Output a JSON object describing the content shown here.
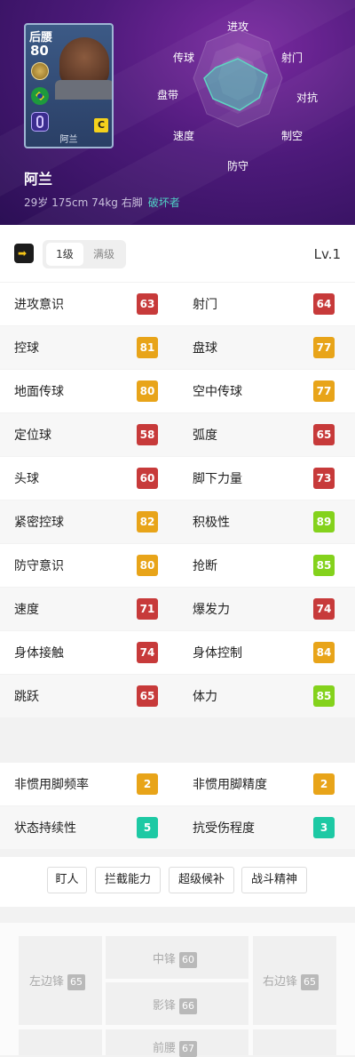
{
  "player": {
    "card_position": "后腰",
    "card_rating": "80",
    "card_name": "阿兰",
    "card_class": "C",
    "name": "阿兰",
    "info": "29岁 175cm 74kg 右脚",
    "play_style": "破坏者"
  },
  "radar": {
    "labels": [
      "进攻",
      "射门",
      "对抗",
      "制空",
      "防守",
      "速度",
      "盘带",
      "传球"
    ]
  },
  "level": {
    "tabs": [
      "1级",
      "满级"
    ],
    "active_tab": "1级",
    "current": "Lv.1"
  },
  "stats": [
    {
      "left": {
        "label": "进攻意识",
        "value": "63",
        "color": "#c73a3a"
      },
      "right": {
        "label": "射门",
        "value": "64",
        "color": "#c73a3a"
      }
    },
    {
      "left": {
        "label": "控球",
        "value": "81",
        "color": "#e8a419"
      },
      "right": {
        "label": "盘球",
        "value": "77",
        "color": "#e8a419"
      }
    },
    {
      "left": {
        "label": "地面传球",
        "value": "80",
        "color": "#e8a419"
      },
      "right": {
        "label": "空中传球",
        "value": "77",
        "color": "#e8a419"
      }
    },
    {
      "left": {
        "label": "定位球",
        "value": "58",
        "color": "#c73a3a"
      },
      "right": {
        "label": "弧度",
        "value": "65",
        "color": "#c73a3a"
      }
    },
    {
      "left": {
        "label": "头球",
        "value": "60",
        "color": "#c73a3a"
      },
      "right": {
        "label": "脚下力量",
        "value": "73",
        "color": "#c73a3a"
      }
    },
    {
      "left": {
        "label": "紧密控球",
        "value": "82",
        "color": "#e8a419"
      },
      "right": {
        "label": "积极性",
        "value": "89",
        "color": "#84d21c"
      }
    },
    {
      "left": {
        "label": "防守意识",
        "value": "80",
        "color": "#e8a419"
      },
      "right": {
        "label": "抢断",
        "value": "85",
        "color": "#84d21c"
      }
    },
    {
      "left": {
        "label": "速度",
        "value": "71",
        "color": "#c73a3a"
      },
      "right": {
        "label": "爆发力",
        "value": "74",
        "color": "#c73a3a"
      }
    },
    {
      "left": {
        "label": "身体接触",
        "value": "74",
        "color": "#c73a3a"
      },
      "right": {
        "label": "身体控制",
        "value": "84",
        "color": "#e8a419"
      }
    },
    {
      "left": {
        "label": "跳跃",
        "value": "65",
        "color": "#c73a3a"
      },
      "right": {
        "label": "体力",
        "value": "85",
        "color": "#84d21c"
      }
    }
  ],
  "extra_stats": [
    {
      "left": {
        "label": "非惯用脚频率",
        "value": "2",
        "color": "#e8a419"
      },
      "right": {
        "label": "非惯用脚精度",
        "value": "2",
        "color": "#e8a419"
      }
    },
    {
      "left": {
        "label": "状态持续性",
        "value": "5",
        "color": "#1dc9a4"
      },
      "right": {
        "label": "抗受伤程度",
        "value": "3",
        "color": "#1dc9a4"
      }
    }
  ],
  "skills": [
    "盯人",
    "拦截能力",
    "超级候补",
    "战斗精神"
  ],
  "positions": {
    "lwf": {
      "label": "左边锋",
      "value": "65"
    },
    "cf": {
      "label": "中锋",
      "value": "60"
    },
    "rwf": {
      "label": "右边锋",
      "value": "65"
    },
    "ss": {
      "label": "影锋",
      "value": "66"
    },
    "amf": {
      "label": "前腰",
      "value": "67"
    }
  }
}
